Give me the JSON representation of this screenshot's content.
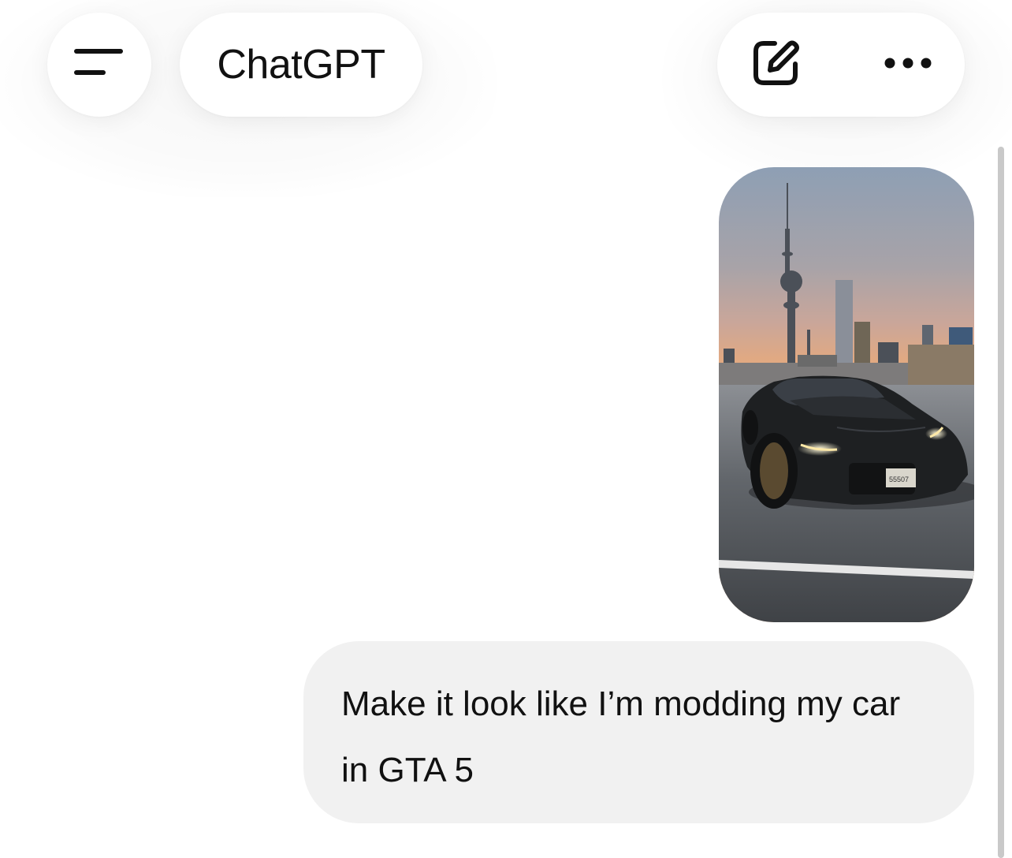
{
  "header": {
    "title": "ChatGPT",
    "menu_icon": "hamburger-menu-icon",
    "compose_icon": "new-chat-compose-icon",
    "more_icon": "more-options-icon"
  },
  "conversation": {
    "user_image": {
      "kind": "photo-attachment",
      "plate_text": "55507"
    },
    "user_message": "Make it look like I’m modding my car in GTA 5"
  },
  "colors": {
    "background": "#ffffff",
    "bubble": "#f1f1f1",
    "text": "#111111",
    "icon": "#111111"
  }
}
